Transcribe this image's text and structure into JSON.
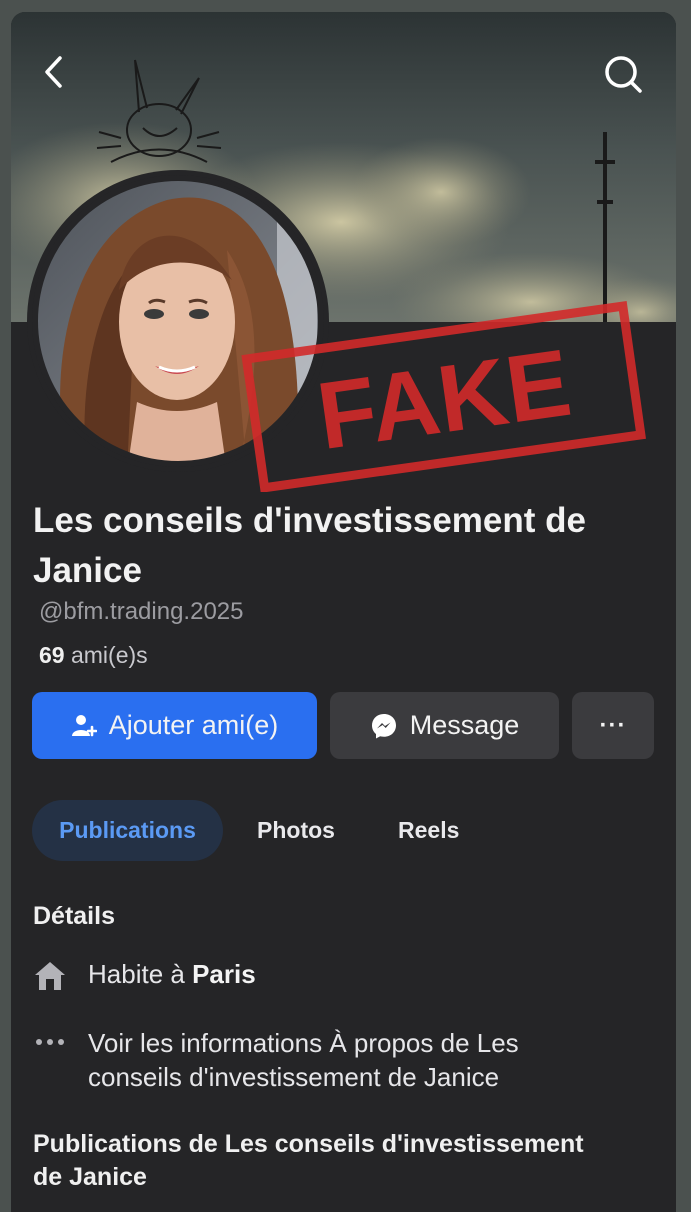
{
  "profile": {
    "name": "Les conseils d'investissement de Janice",
    "handle": "@bfm.trading.2025",
    "friends_count": "69",
    "friends_label": "ami(e)s",
    "stamp_text": "FAKE"
  },
  "actions": {
    "add_friend": "Ajouter ami(e)",
    "message": "Message",
    "more": "···"
  },
  "tabs": [
    {
      "label": "Publications",
      "active": true
    },
    {
      "label": "Photos",
      "active": false
    },
    {
      "label": "Reels",
      "active": false
    }
  ],
  "details": {
    "title": "Détails",
    "lives_prefix": "Habite à",
    "lives_city": "Paris",
    "about_text": "Voir les informations À propos de Les conseils d'investissement de Janice"
  },
  "posts": {
    "title": "Publications de Les conseils d'investissement de Janice"
  },
  "colors": {
    "accent": "#2a6ff0",
    "background": "#252527",
    "stamp": "#d22a2a"
  }
}
